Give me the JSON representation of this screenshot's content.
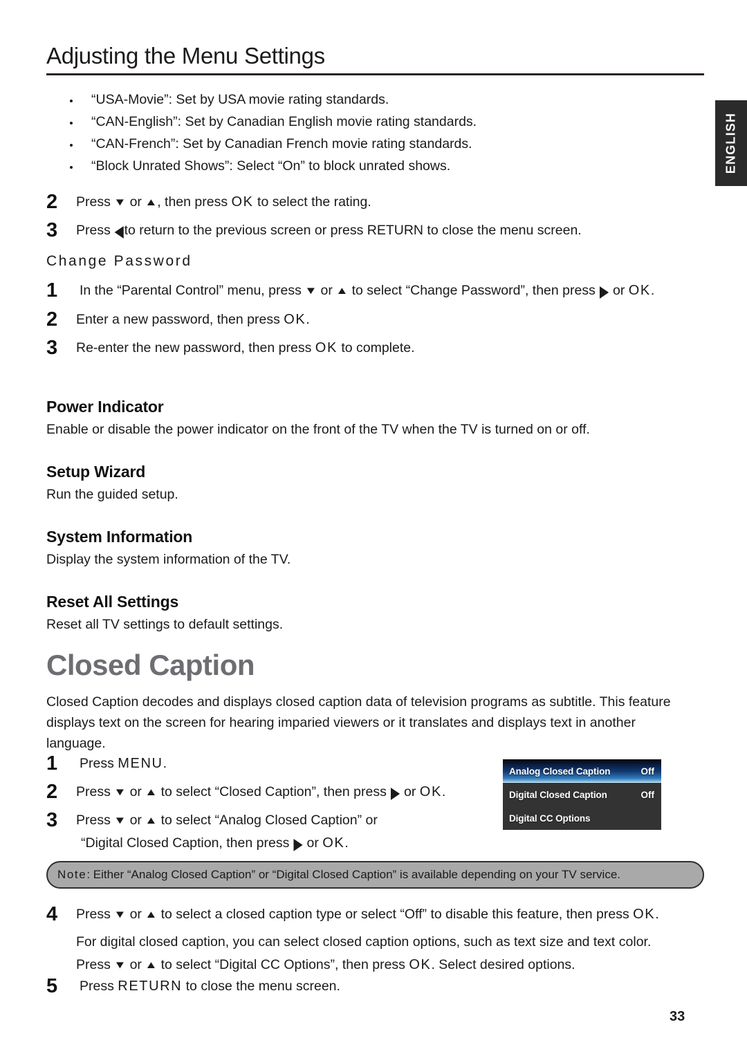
{
  "page": {
    "title": "Adjusting the Menu Settings",
    "number": "33",
    "language_tab": "ENGLISH"
  },
  "bullets": [
    "“USA-Movie”: Set by USA movie rating standards.",
    "“CAN-English”: Set by Canadian English movie rating standards.",
    "“CAN-French”: Set by Canadian French movie rating standards.",
    "“Block Unrated Shows”: Select “On” to block unrated shows."
  ],
  "rating_steps": {
    "step2_num": "2",
    "step2_a": "Press",
    "step2_b": "or",
    "step2_c": ", then press",
    "step2_ok": "OK",
    "step2_d": "to select the rating.",
    "step3_num": "3",
    "step3_a": "Press",
    "step3_b": "to return to the previous screen or press RETURN to close the menu screen."
  },
  "change_password": {
    "heading": "Change Password",
    "step1_num": "1",
    "step1_a": "In the “Parental Control” menu, press",
    "step1_b": "or",
    "step1_c": "to select “Change Password”, then press",
    "step1_d": "or",
    "step1_ok": "OK",
    "step1_e": ".",
    "step2_num": "2",
    "step2_a": "Enter a new password, then press",
    "step2_ok": "OK",
    "step2_b": ".",
    "step3_num": "3",
    "step3_a": "Re-enter the new password, then press",
    "step3_ok": "OK",
    "step3_b": "to complete."
  },
  "sections": [
    {
      "heading": "Power Indicator",
      "body": "Enable or disable the power indicator on the front of the TV when the TV is turned on or off."
    },
    {
      "heading": "Setup Wizard",
      "body": "Run the guided setup."
    },
    {
      "heading": "System Information",
      "body": "Display the system information of the TV."
    },
    {
      "heading": "Reset All Settings",
      "body": "Reset all TV settings to default settings."
    }
  ],
  "closed_caption": {
    "heading": "Closed Caption",
    "intro": "Closed Caption decodes and displays closed caption data of television programs as subtitle. This feature displays text on the screen for hearing imparied viewers or it translates and displays text in another language.",
    "step1_num": "1",
    "step1_a": "Press",
    "step1_menu": "MENU",
    "step1_b": ".",
    "step2_num": "2",
    "step2_a": "Press",
    "step2_b": "or",
    "step2_c": "to select “Closed Caption”, then press",
    "step2_d": "or",
    "step2_ok": "OK",
    "step2_e": ".",
    "step3_num": "3",
    "step3_a": "Press",
    "step3_b": "or",
    "step3_c": "to select “Analog Closed Caption” or",
    "step3_line2_a": "“Digital Closed Caption, then press",
    "step3_line2_b": "or",
    "step3_ok": "OK",
    "step3_line2_c": ".",
    "step4_num": "4",
    "step4_a": "Press",
    "step4_b": "or",
    "step4_c": "to select a closed caption type or select “Off” to disable this feature, then press",
    "step4_ok": "OK",
    "step4_d": ".",
    "step4_p2_line1": "For digital closed caption, you can select closed caption options, such as text size and text color.",
    "step4_p2_line2_a": "Press",
    "step4_p2_line2_b": "or",
    "step4_p2_line2_c": "to select “Digital CC Options”, then press",
    "step4_p2_ok": "OK",
    "step4_p2_line2_d": ". Select desired options.",
    "step5_num": "5",
    "step5_a": "Press",
    "step5_return": "RETURN",
    "step5_b": "to close the menu screen."
  },
  "osd_menu": {
    "rows": [
      {
        "label": "Analog Closed Caption",
        "value": "Off",
        "selected": true
      },
      {
        "label": "Digital Closed Caption",
        "value": "Off",
        "selected": false
      },
      {
        "label": "Digital CC Options",
        "value": "",
        "selected": false
      }
    ]
  },
  "note": {
    "label": "Note",
    "text": ": Either “Analog Closed Caption” or “Digital Closed Caption” is available depending on your TV service."
  },
  "icons": {
    "down": "▼",
    "up": "▲",
    "left": "◀",
    "right": "▶"
  }
}
